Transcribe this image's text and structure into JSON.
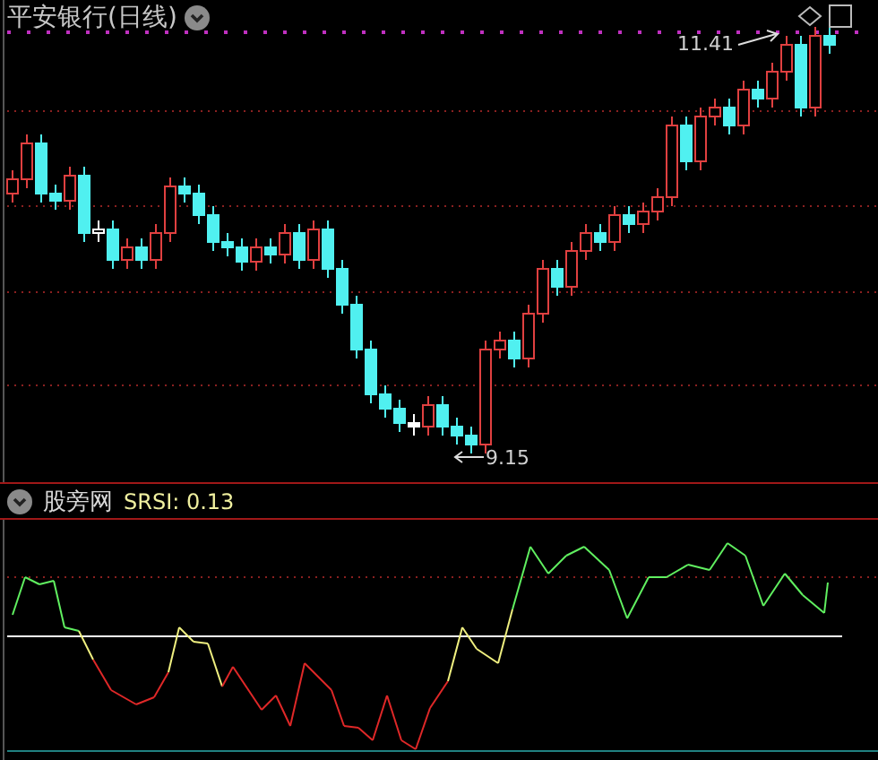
{
  "chart_header": {
    "title": "平安银行(日线)"
  },
  "price_chart": {
    "high_label": "11.41",
    "low_label": "9.15"
  },
  "indicator": {
    "name": "股旁网",
    "reading": "SRSI: 0.13"
  }
}
